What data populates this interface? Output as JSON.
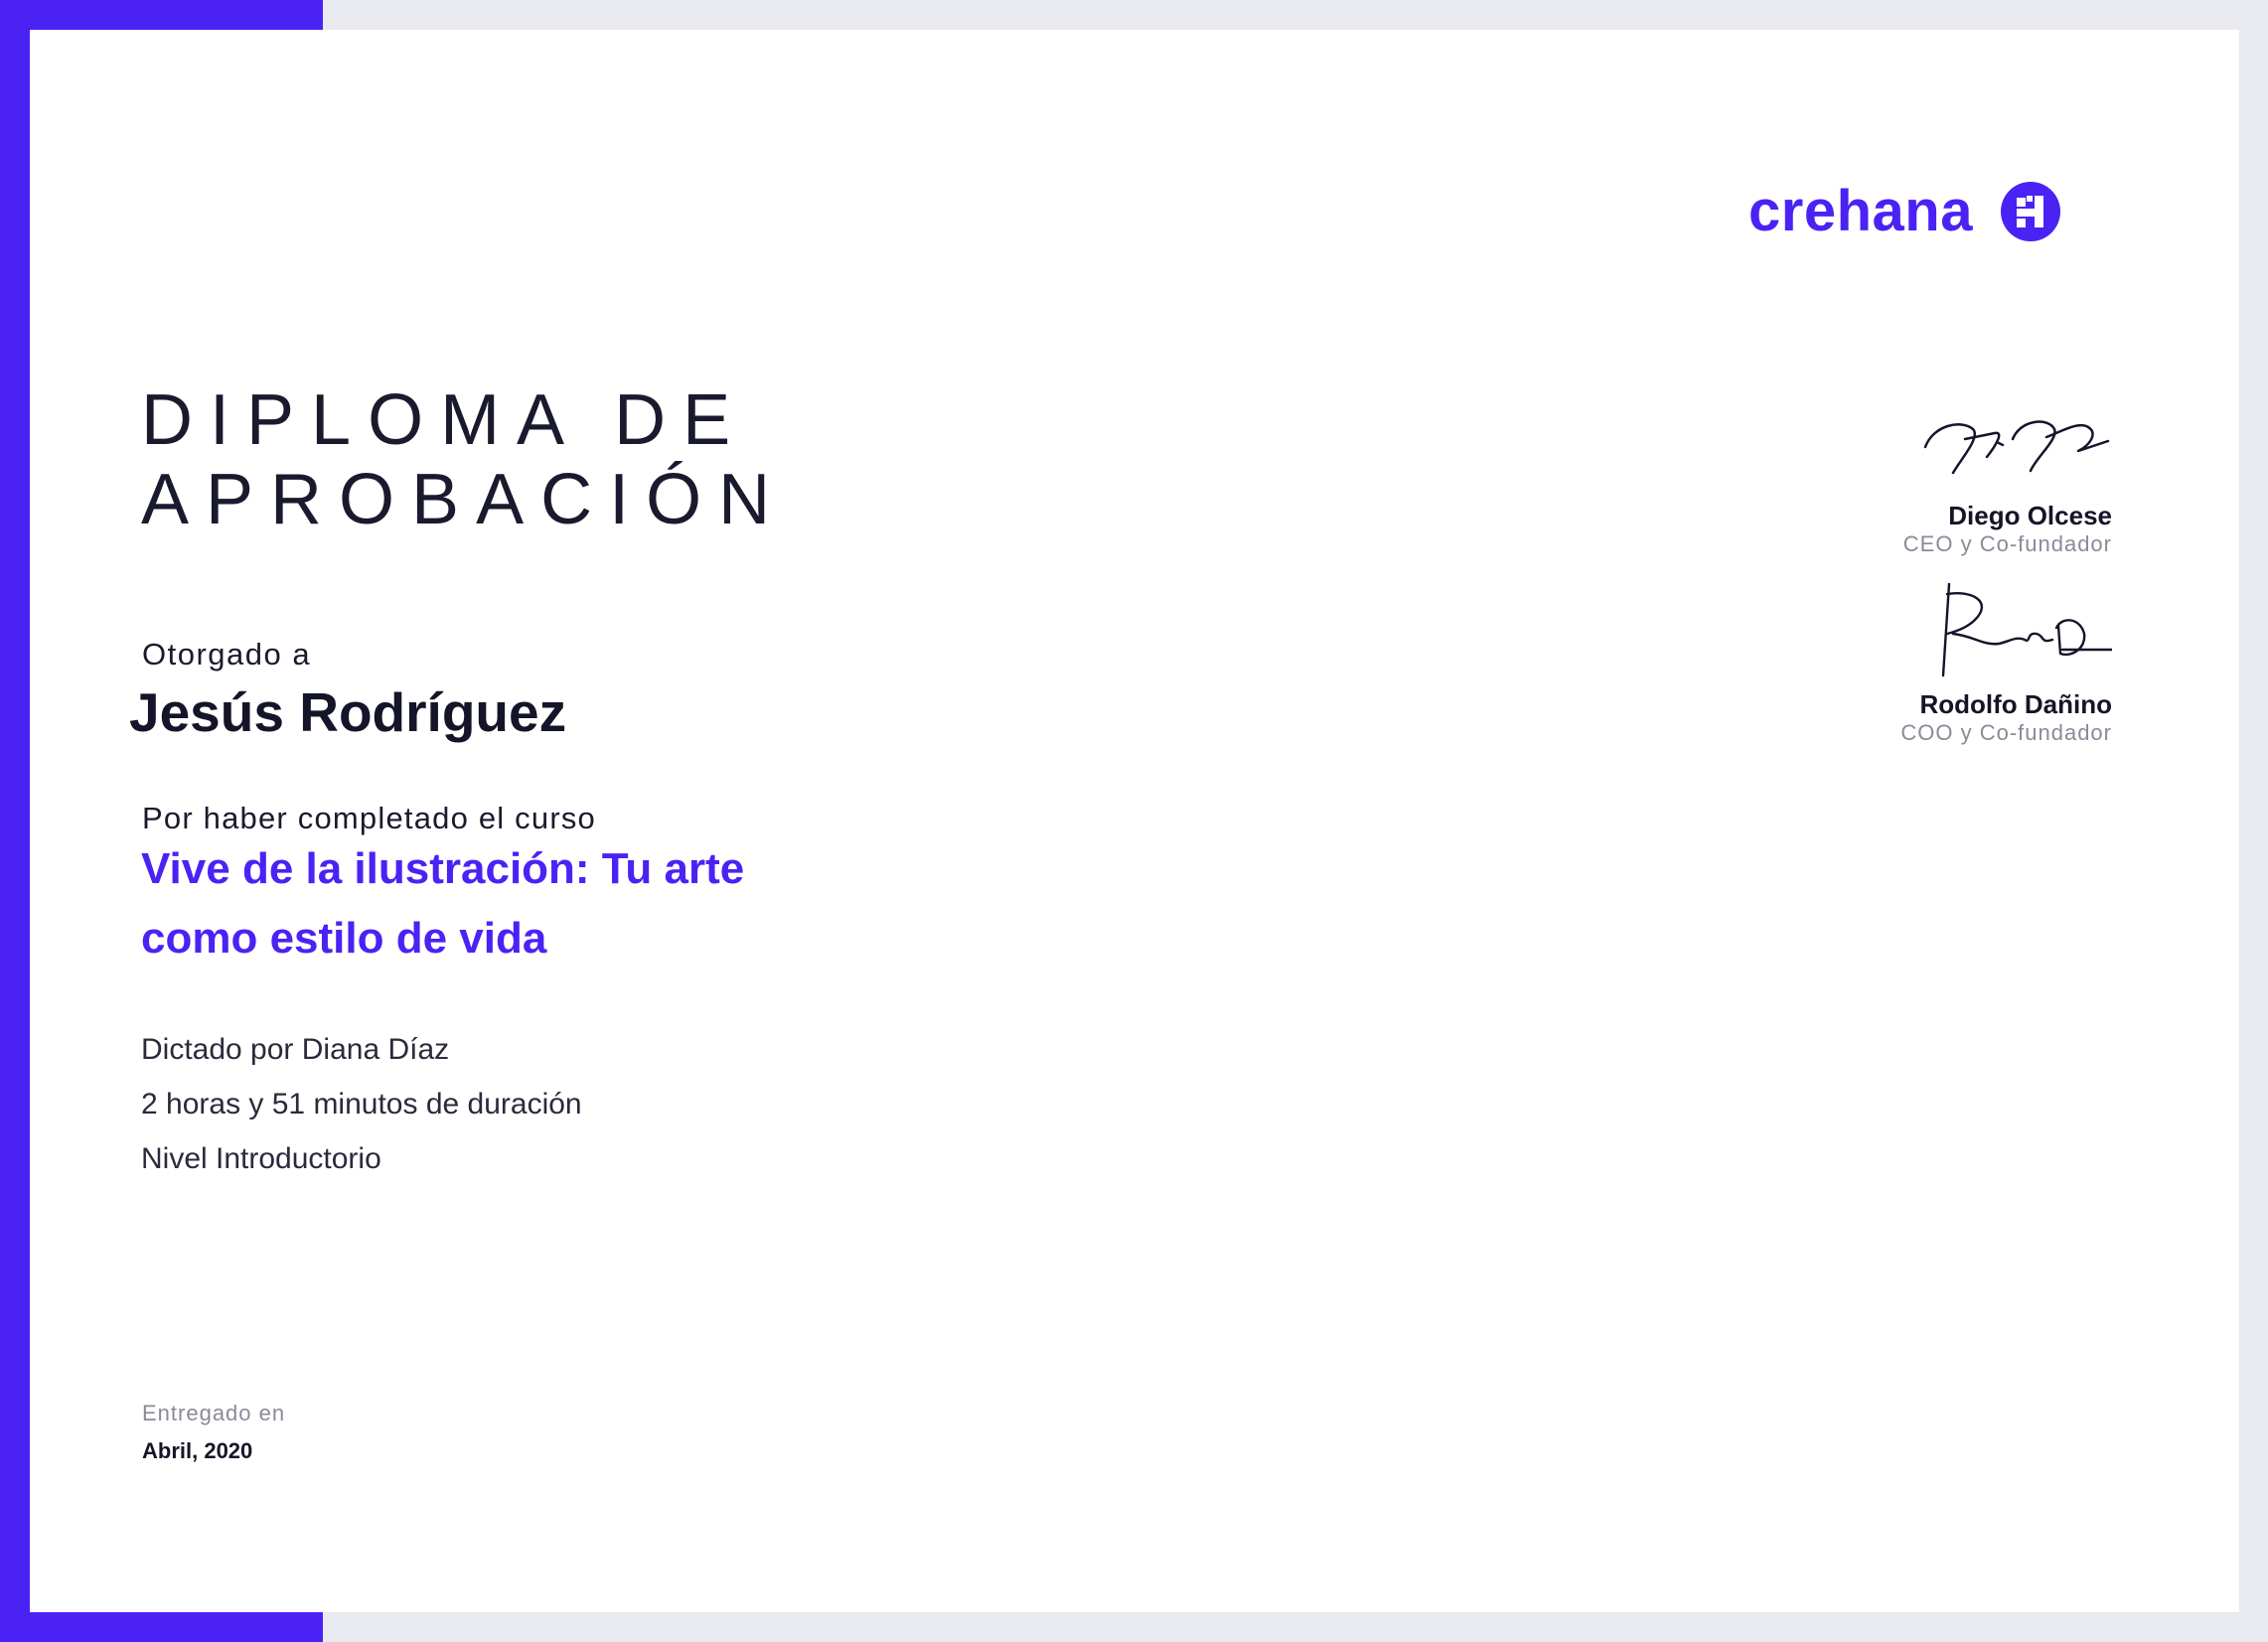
{
  "brand": {
    "name": "crehana",
    "color": "#4b22f4"
  },
  "title": {
    "line1": "DIPLOMA DE",
    "line2": "APROBACIÓN"
  },
  "awarded": {
    "label": "Otorgado a",
    "recipient": "Jesús Rodríguez"
  },
  "course": {
    "label": "Por haber completado el curso",
    "name": "Vive de la ilustración: Tu arte como estilo de vida"
  },
  "details": {
    "instructor": "Dictado por Diana Díaz",
    "duration": "2 horas y 51 minutos de duración",
    "level": "Nivel Introductorio"
  },
  "delivered": {
    "label": "Entregado en",
    "date": "Abril, 2020"
  },
  "signers": [
    {
      "name": "Diego Olcese",
      "role": "CEO y Co-fundador"
    },
    {
      "name": "Rodolfo Dañino",
      "role": "COO y Co-fundador"
    }
  ]
}
